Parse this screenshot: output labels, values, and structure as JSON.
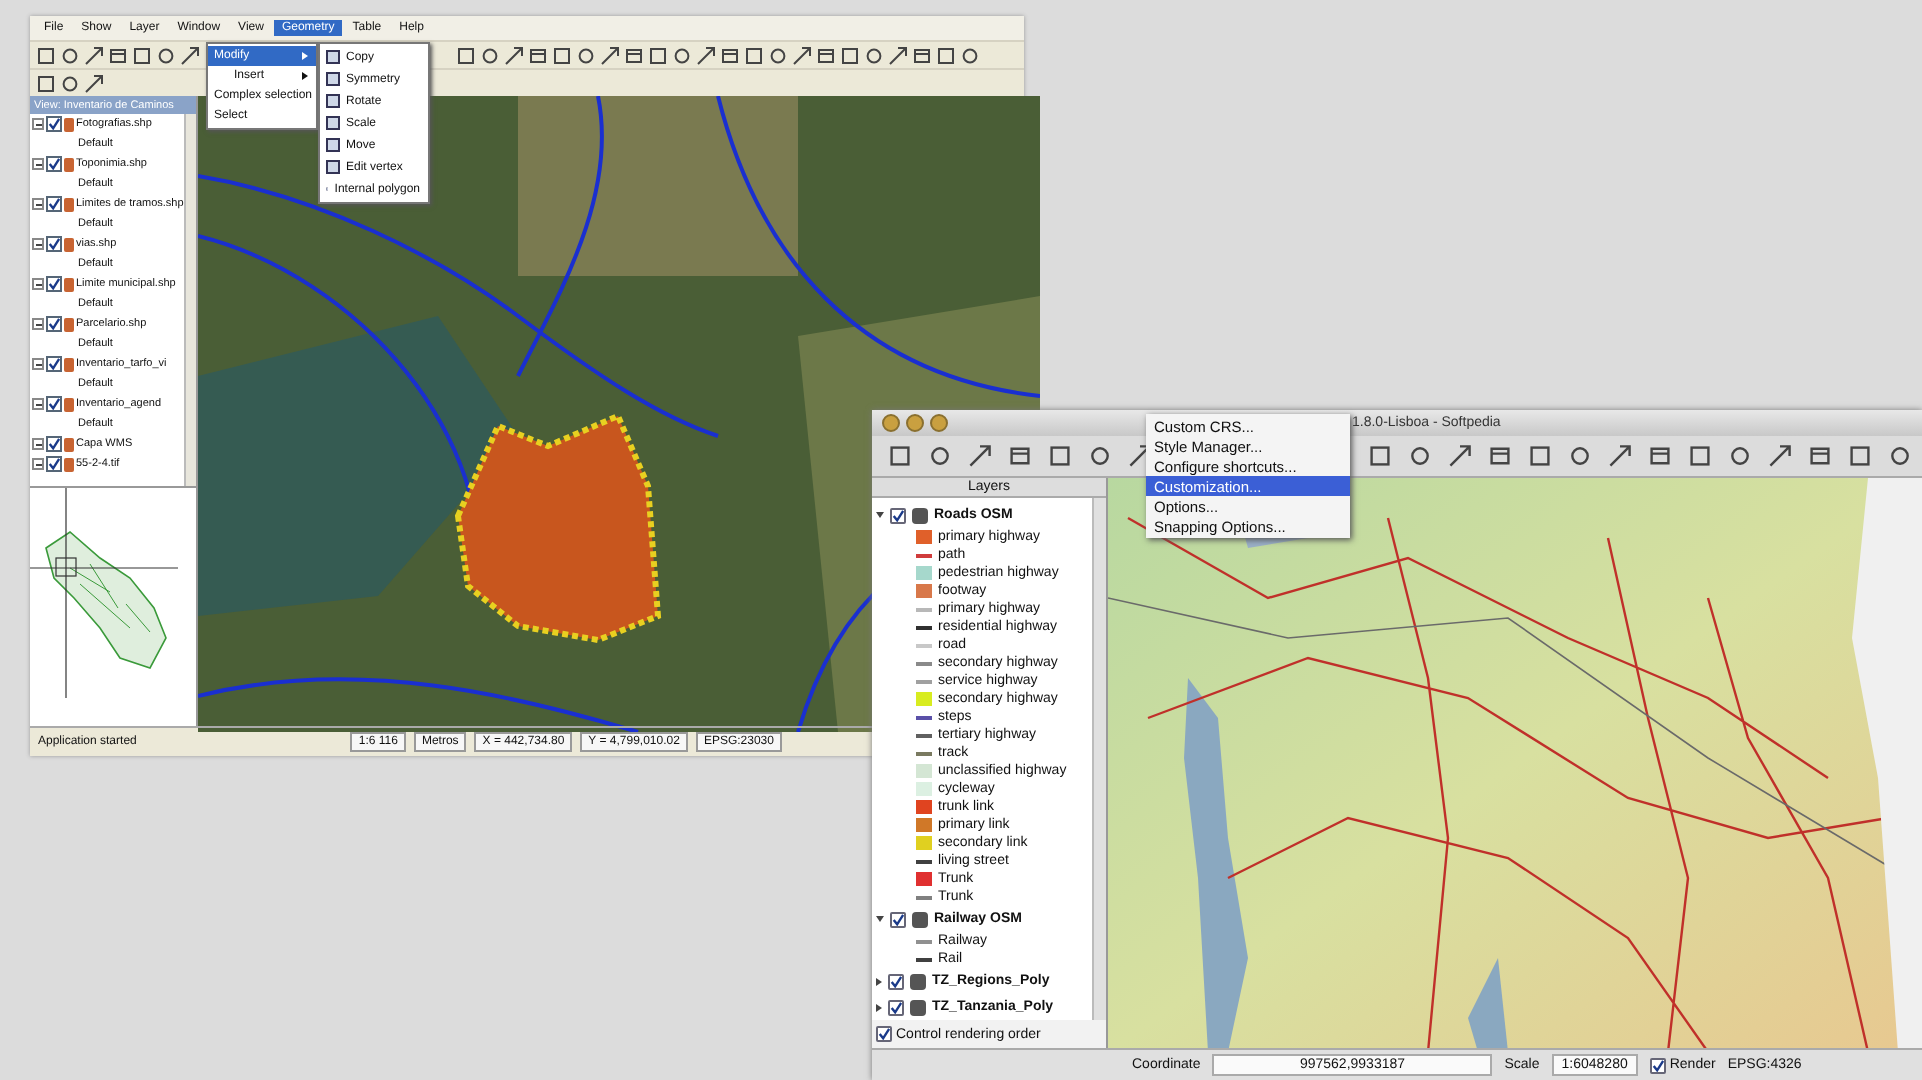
{
  "left_window": {
    "menu": [
      {
        "label": "File",
        "selected": false
      },
      {
        "label": "Show",
        "selected": false
      },
      {
        "label": "Layer",
        "selected": false
      },
      {
        "label": "Window",
        "selected": false
      },
      {
        "label": "View",
        "selected": false
      },
      {
        "label": "Geometry",
        "selected": true
      },
      {
        "label": "Table",
        "selected": false
      },
      {
        "label": "Help",
        "selected": false
      }
    ],
    "geometry_menu": [
      {
        "label": "Modify",
        "selected": true,
        "submenu": true
      },
      {
        "label": "Insert",
        "selected": false,
        "submenu": true
      },
      {
        "label": "Complex selection",
        "selected": false,
        "submenu": false
      },
      {
        "label": "Select",
        "selected": false,
        "submenu": false
      }
    ],
    "modify_submenu": [
      "Copy",
      "Symmetry",
      "Rotate",
      "Scale",
      "Move",
      "Edit vertex",
      "Internal polygon"
    ],
    "view_title": "View: Inventario de Caminos",
    "layers": [
      {
        "name": "Fotografias.shp",
        "checked": true,
        "children": [
          {
            "name": "Default"
          }
        ]
      },
      {
        "name": "Toponimia.shp",
        "checked": true,
        "children": [
          {
            "name": "Default"
          }
        ]
      },
      {
        "name": "Limites de tramos.shp",
        "checked": true,
        "children": [
          {
            "name": "Default"
          }
        ]
      },
      {
        "name": "vias.shp",
        "checked": true,
        "children": [
          {
            "name": "Default"
          }
        ]
      },
      {
        "name": "Limite municipal.shp",
        "checked": true,
        "children": [
          {
            "name": "Default"
          }
        ]
      },
      {
        "name": "Parcelario.shp",
        "checked": true,
        "children": [
          {
            "name": "Default"
          }
        ]
      },
      {
        "name": "Inventario_tarfo_vi",
        "checked": true,
        "children": [
          {
            "name": "Default"
          }
        ]
      },
      {
        "name": "Inventario_agend",
        "checked": true,
        "children": [
          {
            "name": "Default"
          }
        ]
      },
      {
        "name": "Capa WMS",
        "checked": true
      },
      {
        "name": "55-2-4.tif",
        "checked": true
      }
    ],
    "status_bar": {
      "message": "Application started",
      "scale": "1:6 116",
      "units": "Metros",
      "x": "X = 442,734.80",
      "y": "Y = 4,799,010.02",
      "crs": "EPSG:23030"
    }
  },
  "right_window": {
    "title": "1.8.0-Lisboa - Softpedia",
    "settings_menu": [
      {
        "label": "Custom CRS...",
        "selected": false
      },
      {
        "label": "Style Manager...",
        "selected": false
      },
      {
        "label": "Configure shortcuts...",
        "selected": false
      },
      {
        "label": "Customization...",
        "selected": true
      },
      {
        "label": "Options...",
        "selected": false
      },
      {
        "label": "Snapping Options...",
        "selected": false
      }
    ],
    "legend_title": "Layers",
    "legend": [
      {
        "name": "Roads OSM",
        "checked": true,
        "expanded": true,
        "children": [
          {
            "name": "primary highway",
            "kind": "fill",
            "color": "#e0602a"
          },
          {
            "name": "path",
            "kind": "line",
            "color": "#d03c3c"
          },
          {
            "name": "pedestrian highway",
            "kind": "fill",
            "color": "#a6d8cc"
          },
          {
            "name": "footway",
            "kind": "fill",
            "color": "#d8784a"
          },
          {
            "name": "primary highway",
            "kind": "line",
            "color": "#b8b8b8"
          },
          {
            "name": "residential highway",
            "kind": "line",
            "color": "#303030"
          },
          {
            "name": "road",
            "kind": "line",
            "color": "#c8c8c8"
          },
          {
            "name": "secondary highway",
            "kind": "line",
            "color": "#8a8a8a"
          },
          {
            "name": "service highway",
            "kind": "line",
            "color": "#a0a0a0"
          },
          {
            "name": "secondary highway",
            "kind": "fill",
            "color": "#d8ec20"
          },
          {
            "name": "steps",
            "kind": "line",
            "color": "#5a50a8"
          },
          {
            "name": "tertiary highway",
            "kind": "line",
            "color": "#606060"
          },
          {
            "name": "track",
            "kind": "line",
            "color": "#7a7a60"
          },
          {
            "name": "unclassified highway",
            "kind": "fill",
            "color": "#d4e6d4"
          },
          {
            "name": "cycleway",
            "kind": "fill",
            "color": "#dcf0e2"
          },
          {
            "name": "trunk link",
            "kind": "fill",
            "color": "#e04420"
          },
          {
            "name": "primary link",
            "kind": "fill",
            "color": "#d07828"
          },
          {
            "name": "secondary link",
            "kind": "fill",
            "color": "#e0d020"
          },
          {
            "name": "living street",
            "kind": "line",
            "color": "#404040"
          },
          {
            "name": "Trunk",
            "kind": "fill",
            "color": "#e03030"
          },
          {
            "name": "Trunk",
            "kind": "line",
            "color": "#808080"
          }
        ]
      },
      {
        "name": "Railway OSM",
        "checked": true,
        "expanded": true,
        "children": [
          {
            "name": "Railway",
            "kind": "line",
            "color": "#909090"
          },
          {
            "name": "Rail",
            "kind": "line",
            "color": "#404040"
          }
        ]
      },
      {
        "name": "TZ_Regions_Poly",
        "checked": true,
        "expanded": false
      },
      {
        "name": "TZ_Tanzania_Poly",
        "checked": true,
        "expanded": false
      }
    ],
    "render_order": {
      "label": "Control rendering order",
      "checked": true
    },
    "status_bar": {
      "coordinate_label": "Coordinate",
      "coordinate": "997562,9933187",
      "scale_label": "Scale",
      "scale": "1:6048280",
      "render": {
        "label": "Render",
        "checked": true
      },
      "crs": "EPSG:4326"
    }
  }
}
